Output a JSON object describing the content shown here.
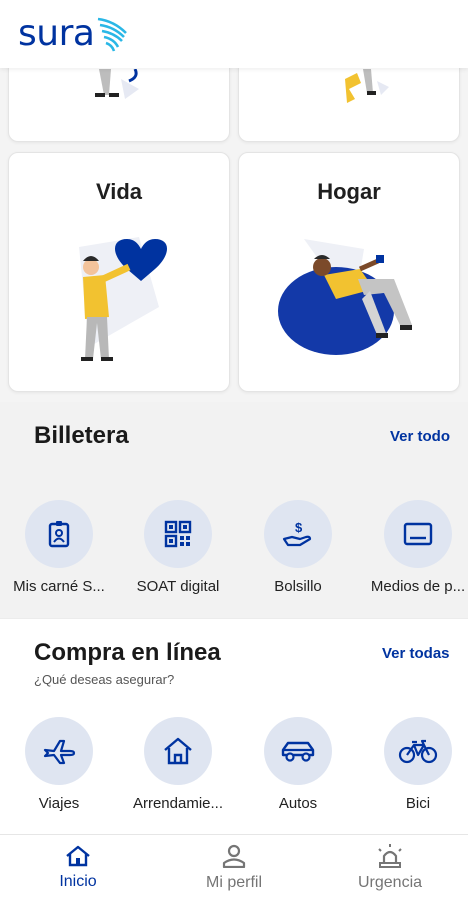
{
  "brand": {
    "logo_text": "sura"
  },
  "cards": [
    {
      "title": ""
    },
    {
      "title": ""
    },
    {
      "title": "Vida"
    },
    {
      "title": "Hogar"
    }
  ],
  "billetera": {
    "title": "Billetera",
    "link": "Ver todo",
    "items": [
      {
        "label": "Mis carné S...",
        "icon": "id-card-icon"
      },
      {
        "label": "SOAT digital",
        "icon": "qr-code-icon"
      },
      {
        "label": "Bolsillo",
        "icon": "money-hand-icon"
      },
      {
        "label": "Medios de p...",
        "icon": "card-screen-icon"
      }
    ]
  },
  "compra": {
    "title": "Compra en línea",
    "subtitle": "¿Qué deseas asegurar?",
    "link": "Ver todas",
    "items": [
      {
        "label": "Viajes",
        "icon": "airplane-icon"
      },
      {
        "label": "Arrendamie...",
        "icon": "house-icon"
      },
      {
        "label": "Autos",
        "icon": "car-icon"
      },
      {
        "label": "Bici",
        "icon": "bicycle-icon"
      }
    ]
  },
  "bottom_nav": {
    "items": [
      {
        "label": "Inicio",
        "icon": "home-icon",
        "active": true
      },
      {
        "label": "Mi perfil",
        "icon": "person-icon",
        "active": false
      },
      {
        "label": "Urgencia",
        "icon": "siren-icon",
        "active": false
      }
    ]
  },
  "colors": {
    "brand_blue": "#0033a0",
    "accent_cyan": "#2ab7e6",
    "yellow": "#f2c230",
    "icon_bg": "#dfe5f1"
  }
}
